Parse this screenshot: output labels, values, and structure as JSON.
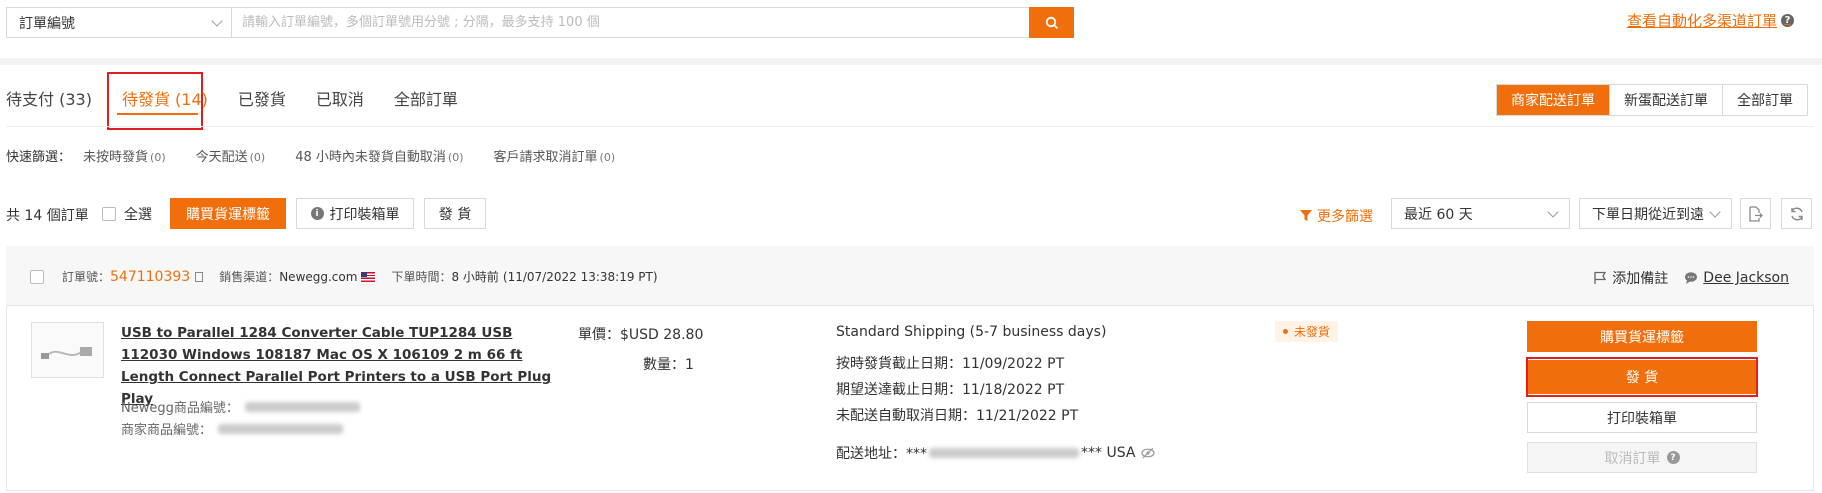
{
  "search": {
    "field_select": "訂單編號",
    "placeholder": "請輸入訂單編號，多個訂單號用分號 ; 分隔，最多支持 100 個"
  },
  "header": {
    "automation_link": "查看自動化多渠道訂單"
  },
  "tabs": [
    {
      "label": "待支付 (33)",
      "active": false
    },
    {
      "label": "待發貨 (14)",
      "active": true
    },
    {
      "label": "已發貨",
      "active": false
    },
    {
      "label": "已取消",
      "active": false
    },
    {
      "label": "全部訂單",
      "active": false
    }
  ],
  "fulfillment_segments": [
    {
      "label": "商家配送訂單",
      "active": true
    },
    {
      "label": "新蛋配送訂單",
      "active": false
    },
    {
      "label": "全部訂單",
      "active": false
    }
  ],
  "quick_filter": {
    "label": "快速篩選：",
    "items": [
      {
        "label": "未按時發貨",
        "count": "(0)"
      },
      {
        "label": "今天配送",
        "count": "(0)"
      },
      {
        "label": "48 小時內未發貨自動取消",
        "count": "(0)"
      },
      {
        "label": "客戶請求取消訂單",
        "count": "(0)"
      }
    ]
  },
  "toolbar": {
    "total": "共 14 個訂單",
    "select_all": "全選",
    "buy_label": "購買貨運標籤",
    "print_packing": "打印裝箱單",
    "ship": "發 貨",
    "more_filter": "更多篩選",
    "date_range": "最近 60 天",
    "sort": "下單日期從近到遠"
  },
  "order": {
    "order_no_label": "訂單號：",
    "order_no": "547110393",
    "channel_label": "銷售渠道：",
    "channel": "Newegg.com",
    "order_time_label": "下單時間：",
    "order_time_rel": "8 小時前",
    "order_time_abs": "(11/07/2022 13:38:19 PT)",
    "add_note": "添加備註",
    "buyer": "Dee Jackson",
    "product_title": "USB to Parallel 1284 Converter Cable TUP1284 USB 112030 Windows 108187 Mac OS X 106109 2 m 66 ft Length Connect Parallel Port Printers to a USB Port Plug Play",
    "newegg_item_label": "Newegg商品編號：",
    "seller_item_label": "商家商品編號：",
    "unit_price": "單價：$USD 28.80",
    "quantity": "數量：1",
    "shipping_method": "Standard Shipping (5-7 business days)",
    "ship_by": "按時發貨截止日期：11/09/2022 PT",
    "deliver_by": "期望送達截止日期：11/18/2022 PT",
    "auto_cancel": "未配送自動取消日期：11/21/2022 PT",
    "address_label": "配送地址：***",
    "address_suffix": "*** USA",
    "status": "未發貨",
    "actions": {
      "buy_label": "購買貨運標籤",
      "ship": "發 貨",
      "print_packing": "打印裝箱單",
      "cancel": "取消訂單"
    }
  },
  "colors": {
    "accent": "#f06f0c",
    "highlight": "#e02020"
  }
}
